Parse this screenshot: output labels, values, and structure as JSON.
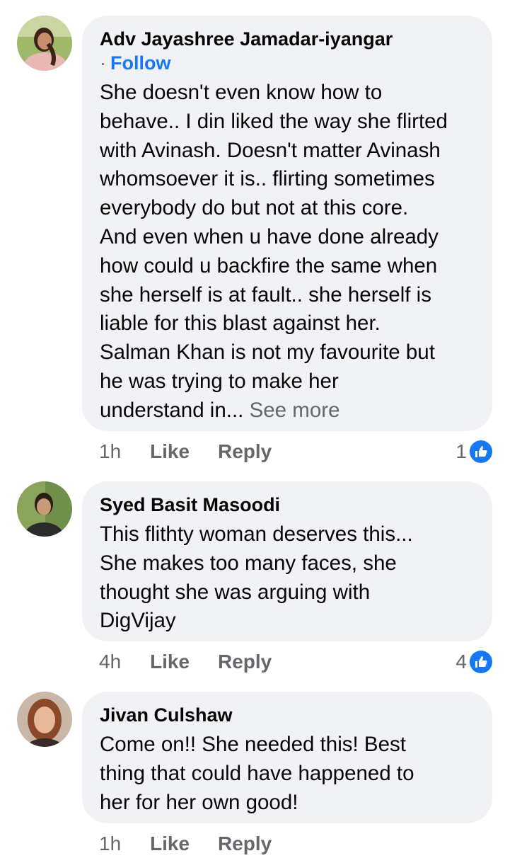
{
  "comments": [
    {
      "author": "Adv Jayashree Jamadar-iyangar",
      "follow_label": "Follow",
      "follow_dot": "·",
      "text": "She doesn't even know how to\nbehave.. I din liked the way she flirted\nwith Avinash. Doesn't matter Avinash\nwhomsoever it is.. flirting sometimes\neverybody do but not at this core.\nAnd even when u have done already\nhow could u backfire the same when\nshe herself is at fault.. she herself is\nliable for this blast against her.\nSalman Khan is not my favourite but\nhe was trying to make her\nunderstand in...",
      "see_more": "See more",
      "time": "1h",
      "like_label": "Like",
      "reply_label": "Reply",
      "reaction_count": "1"
    },
    {
      "author": "Syed Basit Masoodi",
      "text": "This flithty woman deserves this...\nShe makes too many faces, she\nthought she was arguing with\nDigVijay",
      "time": "4h",
      "like_label": "Like",
      "reply_label": "Reply",
      "reaction_count": "4"
    },
    {
      "author": "Jivan Culshaw",
      "text": "Come on!! She needed this! Best\nthing that could have happened to\nher for her own good!",
      "time": "1h",
      "like_label": "Like",
      "reply_label": "Reply"
    }
  ],
  "colors": {
    "bubble_bg": "#f0f2f5",
    "link_blue": "#1877f2",
    "secondary_text": "#65676b"
  },
  "icons": {
    "reaction": "like-thumb-icon"
  }
}
